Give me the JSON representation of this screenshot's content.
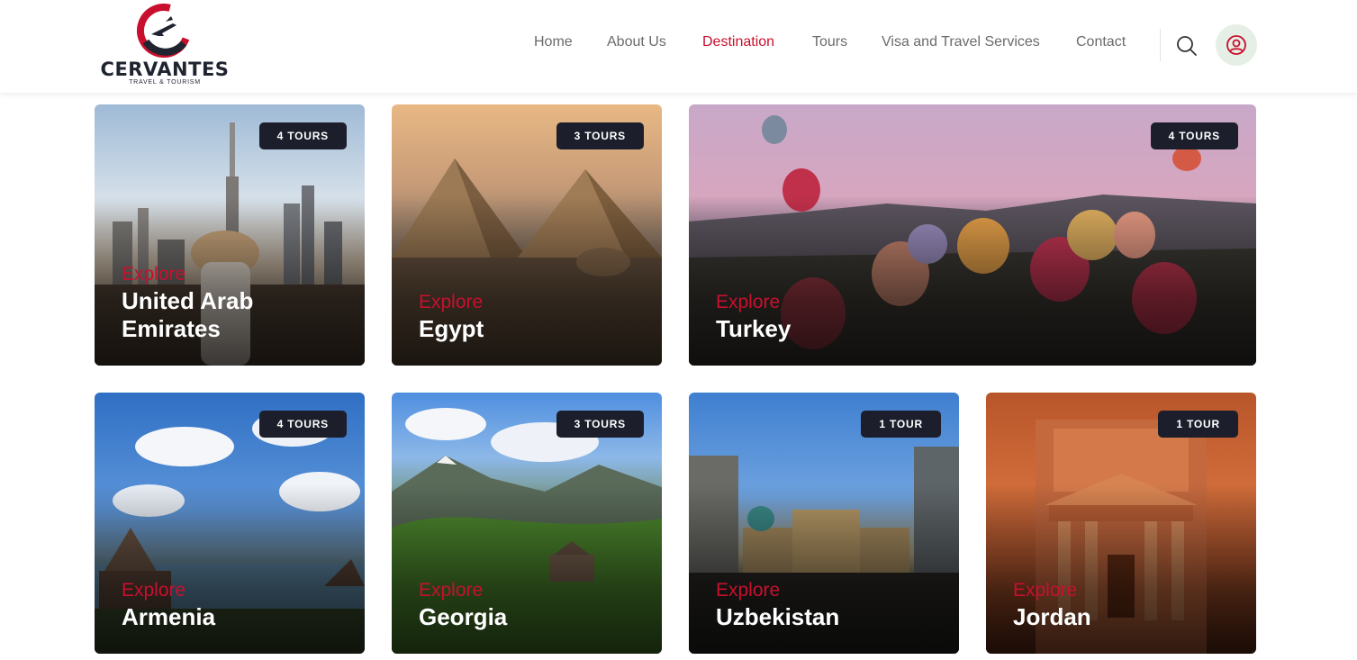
{
  "brand": {
    "name": "CERVANTES",
    "tagline": "TRAVEL & TOURISM",
    "colors": {
      "accent": "#c8102e",
      "dark": "#1f2430",
      "badge": "#1c1f2b"
    }
  },
  "nav": {
    "items": [
      {
        "label": "Home",
        "active": false
      },
      {
        "label": "About Us",
        "active": false
      },
      {
        "label": "Destination",
        "active": true
      },
      {
        "label": "Tours",
        "active": false
      },
      {
        "label": "Visa and Travel Services",
        "active": false
      },
      {
        "label": "Contact",
        "active": false
      }
    ],
    "icons": {
      "search": "search-icon",
      "user": "user-icon"
    }
  },
  "destinations": [
    {
      "tours": "4 TOURS",
      "explore": "Explore",
      "name_line1": "United Arab",
      "name_line2": "Emirates"
    },
    {
      "tours": "3 TOURS",
      "explore": "Explore",
      "name_line1": "Egypt"
    },
    {
      "tours": "4 TOURS",
      "explore": "Explore",
      "name_line1": "Turkey"
    },
    {
      "tours": "4 TOURS",
      "explore": "Explore",
      "name_line1": "Armenia"
    },
    {
      "tours": "3 TOURS",
      "explore": "Explore",
      "name_line1": "Georgia"
    },
    {
      "tours": "1 TOUR",
      "explore": "Explore",
      "name_line1": "Uzbekistan"
    },
    {
      "tours": "1 TOUR",
      "explore": "Explore",
      "name_line1": "Jordan"
    }
  ]
}
